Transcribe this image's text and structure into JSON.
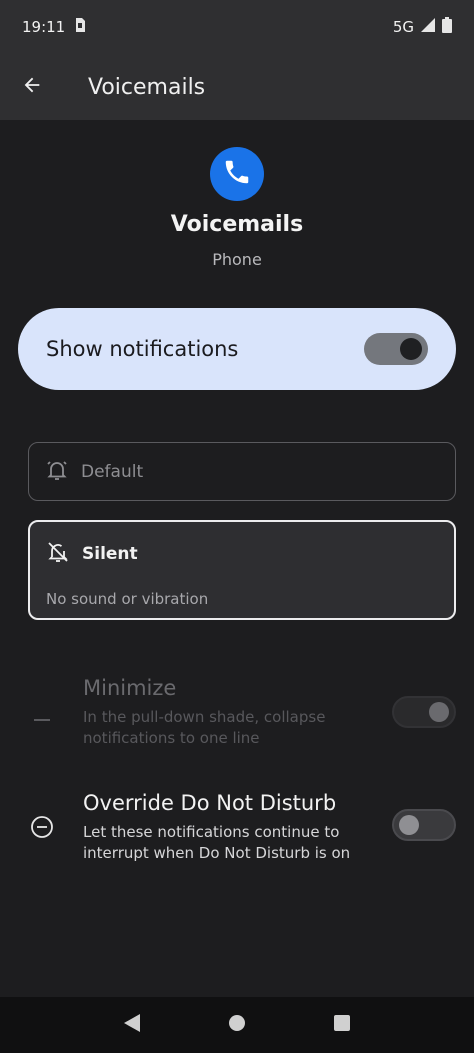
{
  "status_bar": {
    "time": "19:11",
    "network": "5G"
  },
  "app_bar": {
    "title": "Voicemails"
  },
  "header": {
    "channel_name": "Voicemails",
    "app_name": "Phone"
  },
  "show_notifications": {
    "label": "Show notifications",
    "enabled": true
  },
  "options": {
    "default": {
      "label": "Default"
    },
    "silent": {
      "label": "Silent",
      "description": "No sound or vibration",
      "selected": true
    }
  },
  "minimize": {
    "title": "Minimize",
    "description": "In the pull-down shade, collapse notifications to one line",
    "enabled": true,
    "disabled_state": true
  },
  "override_dnd": {
    "title": "Override Do Not Disturb",
    "description": "Let these notifications continue to interrupt when Do Not Disturb is on",
    "enabled": false
  },
  "colors": {
    "accent": "#1a73e8",
    "card_bg": "#d9e4fb",
    "background": "#1d1d1f"
  },
  "icons": [
    "back-arrow-icon",
    "phone-icon",
    "bell-icon",
    "bell-off-icon",
    "minus-icon",
    "dnd-icon",
    "nav-back-icon",
    "nav-home-icon",
    "nav-recents-icon"
  ]
}
